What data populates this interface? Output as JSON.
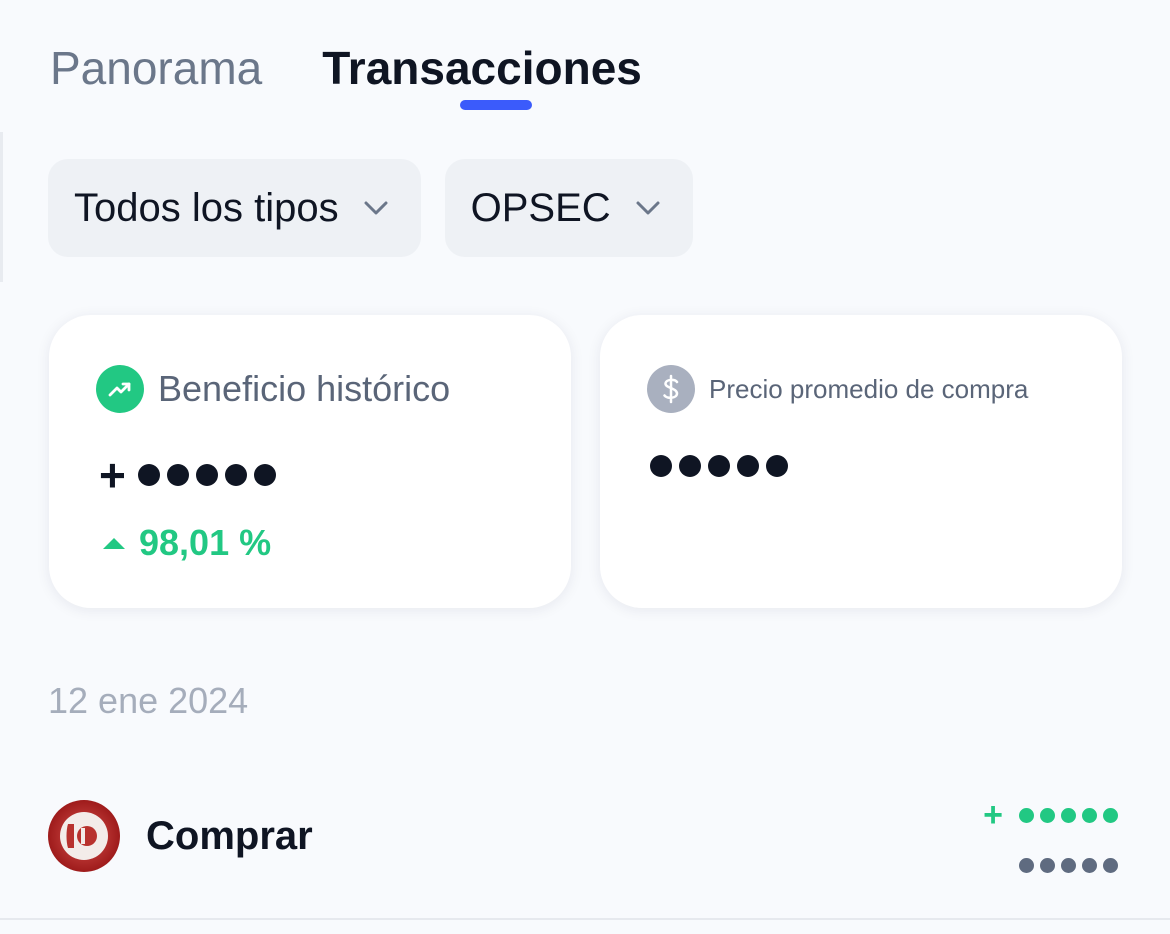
{
  "tabs": [
    {
      "label": "Panorama",
      "active": false
    },
    {
      "label": "Transacciones",
      "active": true
    }
  ],
  "filters": {
    "type": {
      "value": "Todos los tipos",
      "icon": "chevron-down-icon"
    },
    "asset": {
      "value": "OPSEC",
      "icon": "chevron-down-icon"
    }
  },
  "cards": {
    "profit": {
      "title": "Beneficio histórico",
      "icon": "trending-up-icon",
      "icon_color": "#22c883",
      "value_masked": "+●●●●●",
      "change": "98,01 %",
      "change_direction": "up",
      "change_color": "#22c883"
    },
    "avg_price": {
      "title": "Precio promedio de compra",
      "icon": "dollar-icon",
      "icon_color": "#a9b0bf",
      "value_masked": "●●●●●"
    }
  },
  "transactions": [
    {
      "date": "12 ene 2024",
      "items": [
        {
          "type": "Comprar",
          "icon": "opsec-token-logo",
          "amount_masked": "+●●●●●",
          "amount_color": "#22c883",
          "value_masked": "●●●●●",
          "value_color": "#5f6b80"
        }
      ]
    }
  ],
  "colors": {
    "accent": "#3b5bfb",
    "positive": "#22c883",
    "background": "#f8fafd"
  }
}
